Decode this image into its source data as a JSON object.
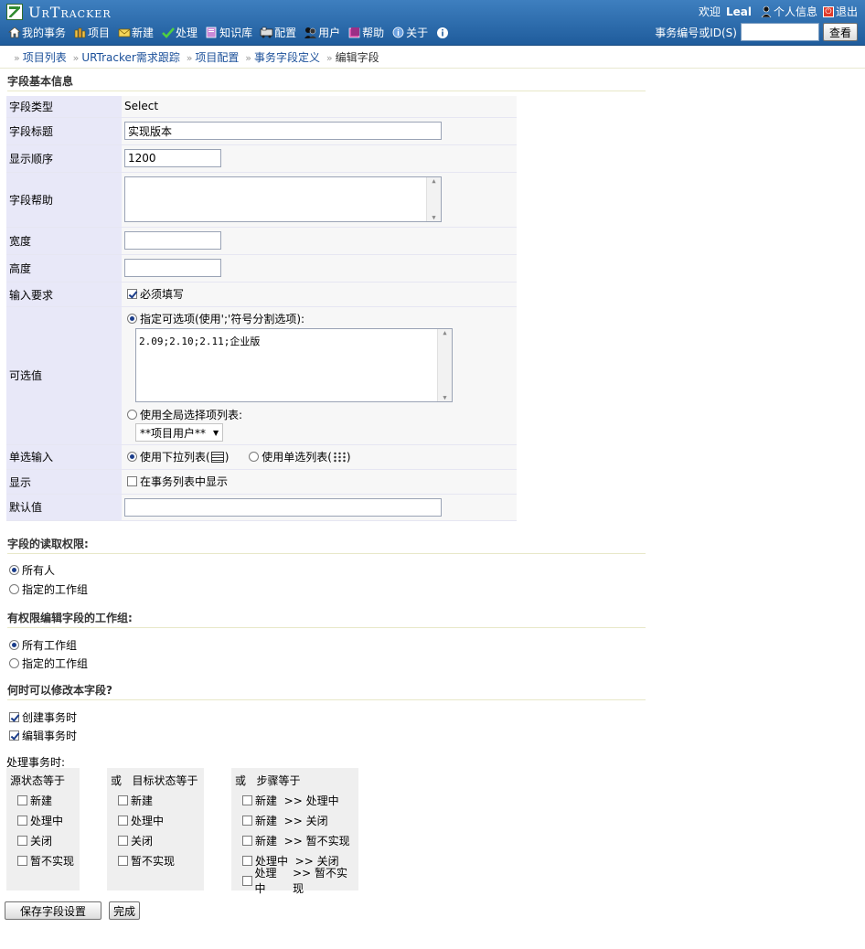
{
  "app": {
    "logo_text": "UrTracker"
  },
  "nav": [
    {
      "label": "我的事务",
      "icon": "home-icon"
    },
    {
      "label": "项目",
      "icon": "project-icon"
    },
    {
      "label": "新建",
      "icon": "new-icon"
    },
    {
      "label": "处理",
      "icon": "check-icon"
    },
    {
      "label": "知识库",
      "icon": "book-icon"
    },
    {
      "label": "配置",
      "icon": "config-icon"
    },
    {
      "label": "用户",
      "icon": "users-icon"
    },
    {
      "label": "帮助",
      "icon": "help-icon"
    },
    {
      "label": "关于",
      "icon": "info-icon"
    }
  ],
  "user": {
    "welcome": "欢迎",
    "name": "Leal",
    "profile": "个人信息",
    "logout": "退出"
  },
  "search": {
    "label": "事务编号或ID(S)",
    "value": "",
    "button": "查看"
  },
  "breadcrumb": [
    {
      "label": "项目列表",
      "link": true
    },
    {
      "label": "URTracker需求跟踪",
      "link": true
    },
    {
      "label": "项目配置",
      "link": true
    },
    {
      "label": "事务字段定义",
      "link": true
    },
    {
      "label": "编辑字段",
      "link": false
    }
  ],
  "sections": {
    "basic": "字段基本信息",
    "read": "字段的读取权限:",
    "edit": "有权限编辑字段的工作组:",
    "when": "何时可以修改本字段?"
  },
  "form": {
    "type_label": "字段类型",
    "type_value": "Select",
    "title_label": "字段标题",
    "title_value": "实现版本",
    "order_label": "显示顺序",
    "order_value": "1200",
    "help_label": "字段帮助",
    "help_value": "",
    "width_label": "宽度",
    "width_value": "",
    "height_label": "高度",
    "height_value": "",
    "required_label": "输入要求",
    "required_option": "必须填写",
    "options_label": "可选值",
    "opt_specified": "指定可选项(使用';'符号分割选项):",
    "opt_specified_value": "2.09;2.10;2.11;企业版",
    "opt_global": "使用全局选择项列表:",
    "opt_global_select": "**项目用户**",
    "single_label": "单选输入",
    "single_dropdown": "使用下拉列表(",
    "single_radio": "使用单选列表(",
    "display_label": "显示",
    "display_option": "在事务列表中显示",
    "default_label": "默认值",
    "default_value": ""
  },
  "read_perm": {
    "all": "所有人",
    "group": "指定的工作组"
  },
  "edit_perm": {
    "all": "所有工作组",
    "group": "指定的工作组"
  },
  "when_edit": {
    "create": "创建事务时",
    "edit": "编辑事务时"
  },
  "process": {
    "label": "处理事务时:",
    "source": {
      "head": "源状态等于",
      "items": [
        "新建",
        "处理中",
        "关闭",
        "暂不实现"
      ]
    },
    "target": {
      "or": "或",
      "head": "目标状态等于",
      "items": [
        "新建",
        "处理中",
        "关闭",
        "暂不实现"
      ]
    },
    "steps": {
      "or": "或",
      "head": "步骤等于",
      "items": [
        {
          "from": "新建",
          "to": ">> 处理中"
        },
        {
          "from": "新建",
          "to": ">> 关闭"
        },
        {
          "from": "新建",
          "to": ">> 暂不实现"
        },
        {
          "from": "处理中",
          "to": ">> 关闭"
        },
        {
          "from": "处理中",
          "to": ">> 暂不实现"
        }
      ]
    }
  },
  "buttons": {
    "save": "保存字段设置",
    "done": "完成"
  }
}
